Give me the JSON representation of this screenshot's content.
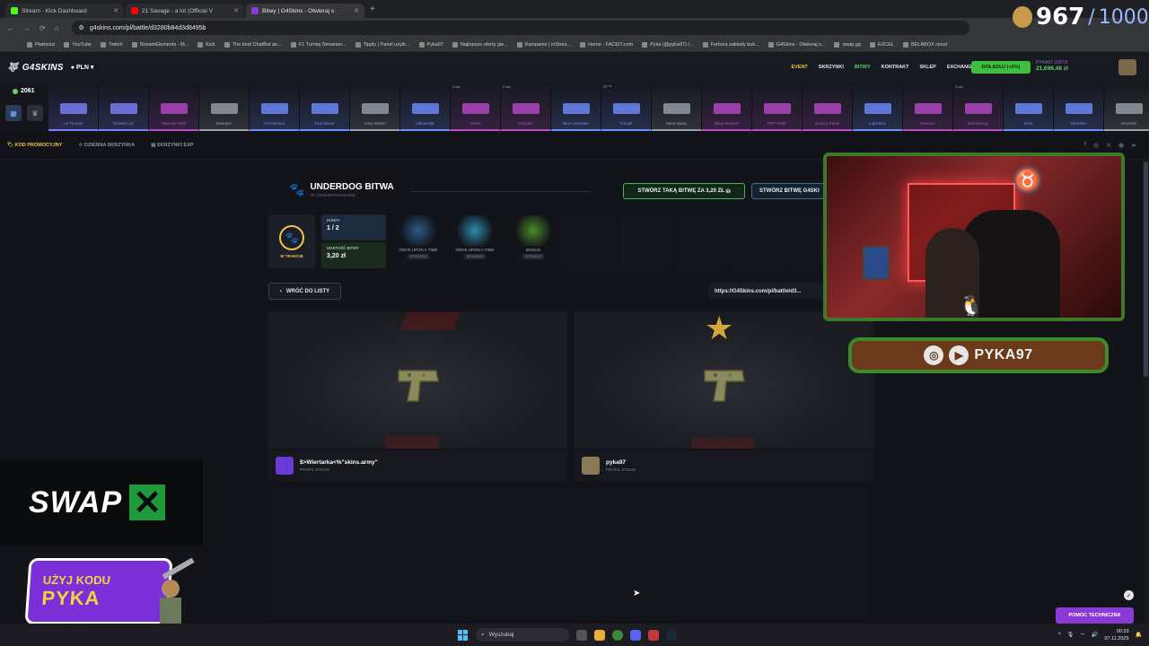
{
  "browser": {
    "tabs": [
      {
        "title": "Stream - Kick Dashboard",
        "color": "#53fc18"
      },
      {
        "title": "21 Savage - a lot (Official V",
        "color": "#ff0000"
      },
      {
        "title": "Bitwy | G4Skins - Otwieraj s",
        "color": "#8a3ad6"
      }
    ],
    "url": "g4skins.com/pl/battle/d3280b84d3d8495b",
    "bookmarks": [
      "Płatności",
      "YouTube",
      "Twitch",
      "StreamElements - M...",
      "Kick",
      "The best ChatBot an...",
      "F1 Turniej Streamer...",
      "Tipply | Panel użytk...",
      "Pyka97",
      "Najlepsze oferty gie...",
      "Kampanie | inStrea...",
      "Home - FACEIT.com",
      "Pyka (@pyka97) /...",
      "Fortuna zakłady buk...",
      "G4Skins - Otwieraj s...",
      "swap.gg",
      "EXCEL",
      "BELABOX cloud"
    ]
  },
  "header": {
    "logo": "G4SKINS",
    "currency": "PLN",
    "nav": [
      "EVENT",
      "SKRZYNKI",
      "BITWY",
      "KONTRAKT",
      "SKLEP",
      "EXCHANGER"
    ],
    "topup": "DOŁADUJ (+5%)",
    "user_label": "PYKA97",
    "user_sub": "3057/5",
    "balance": "21,696,48 zł"
  },
  "ribbon": {
    "online_count": "2061",
    "drops": [
      {
        "name": "Lil' Toucan",
        "color": "#7c82ff",
        "tag": ""
      },
      {
        "name": "Chicken LC",
        "color": "#7c82ff",
        "tag": ""
      },
      {
        "name": "Titanium SMP",
        "color": "#b84ac9",
        "tag": ""
      },
      {
        "name": "Sweeper",
        "color": "#9aa0aa",
        "tag": ""
      },
      {
        "name": "Cirrostratus",
        "color": "#6f8cff",
        "tag": ""
      },
      {
        "name": "Trail Blazer",
        "color": "#6f8cff",
        "tag": ""
      },
      {
        "name": "Army Sheen",
        "color": "#9aa0aa",
        "tag": ""
      },
      {
        "name": "Ultraviolet",
        "color": "#6f8cff",
        "tag": ""
      },
      {
        "name": "Jetfire",
        "color": "#b84ac9",
        "tag": "2 szt."
      },
      {
        "name": "Chopper",
        "color": "#b84ac9",
        "tag": "2 szt."
      },
      {
        "name": "Blue Laminate",
        "color": "#6f8cff",
        "tag": ""
      },
      {
        "name": "Freight",
        "color": "#6f8cff",
        "tag": "ST™"
      },
      {
        "name": "Sand Spray",
        "color": "#9aa0aa",
        "tag": ""
      },
      {
        "name": "Wave Breaker",
        "color": "#b84ac9",
        "tag": ""
      },
      {
        "name": "PDP XWP",
        "color": "#b84ac9",
        "tag": ""
      },
      {
        "name": "Control Panel",
        "color": "#b84ac9",
        "tag": ""
      },
      {
        "name": "Light Box",
        "color": "#6f8cff",
        "tag": ""
      },
      {
        "name": "Random",
        "color": "#b84ac9",
        "tag": ""
      },
      {
        "name": "Bolt Energy",
        "color": "#b84ac9",
        "tag": "2 szt."
      },
      {
        "name": "Grim",
        "color": "#6f8cff",
        "tag": ""
      },
      {
        "name": "Demeter",
        "color": "#6f8cff",
        "tag": ""
      },
      {
        "name": "Emirtrail",
        "color": "#9aa0aa",
        "tag": ""
      }
    ]
  },
  "subnav": [
    "KOD PROMOCYJNY",
    "DZIENNA SKRZYNKA",
    "SKRZYNKI EXP"
  ],
  "battle": {
    "title": "UNDERDOG BITWA",
    "id": "ID: D3280B84D3D8495B",
    "create_same": "STWÓRZ TAKĄ BITWĘ ZA 3,20 ZŁ",
    "create_other": "STWÓRZ BITWĘ G4SKI",
    "status": "W TRAKCIE",
    "players": "2",
    "rounds_label": "RUNDY",
    "rounds_value": "1 / 2",
    "value_label": "WARTOŚĆ BITWY",
    "value_value": "3,20 zł",
    "cases": [
      {
        "name": "ONCE UPON A TIME",
        "tag": "SPRAWDŹ",
        "color": "#2c5b88"
      },
      {
        "name": "ONCE UPON A TIME",
        "tag": "SPRAWDŹ",
        "color": "#2a8aa8"
      },
      {
        "name": "BONUS",
        "tag": "SPRAWDŹ",
        "color": "#4a8a2a"
      }
    ],
    "back": "WRÓĆ DO LISTY",
    "share_url": "https://G4Skins.com/pl/battle/d3...",
    "players_list": [
      {
        "name": "$>Wiertarka<%\"skins.army\"",
        "sub": "PROFIL STEAM",
        "color": "#6b3ad6"
      },
      {
        "name": "pyka97",
        "sub": "PROFIL STEAM",
        "color": "#8a7a5a"
      }
    ]
  },
  "overlay": {
    "viewers_now": "967",
    "viewers_goal": "1000",
    "social_name": "PYKA97",
    "sponsor": "SWAP",
    "code_line1": "UŻYJ KODU",
    "code_line2": "PYKA"
  },
  "help": "POMOC TECHNICZNA",
  "taskbar": {
    "search": "Wyszukaj",
    "time": "00:33",
    "date": "07.11.2025"
  }
}
